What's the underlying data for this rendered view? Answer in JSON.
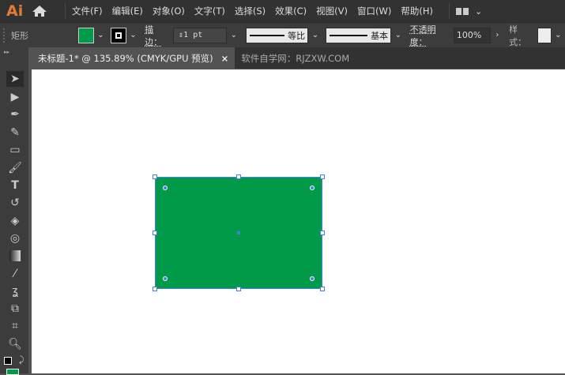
{
  "app": {
    "logo": "Ai"
  },
  "menu": [
    "文件(F)",
    "编辑(E)",
    "对象(O)",
    "文字(T)",
    "选择(S)",
    "效果(C)",
    "视图(V)",
    "窗口(W)",
    "帮助(H)"
  ],
  "control": {
    "tool_name": "矩形",
    "fill_color": "#009a48",
    "stroke_label": "描边：",
    "stroke_weight": "1 pt",
    "profile1": "等比",
    "profile2": "基本",
    "opacity_label": "不透明度：",
    "opacity": "100%",
    "style_label": "样式："
  },
  "tabs": [
    {
      "label": "未标题-1* @ 135.89% (CMYK/GPU 预览)",
      "close": "×"
    },
    {
      "label": "软件自学网：RJZXW.COM"
    }
  ],
  "tools": [
    "selection",
    "direct-selection",
    "pen",
    "curvature",
    "rectangle",
    "paintbrush",
    "type",
    "rotate",
    "eraser",
    "shape-builder",
    "gradient",
    "eyedropper",
    "puppet-warp",
    "live-paint",
    "artboard",
    "zoom"
  ]
}
